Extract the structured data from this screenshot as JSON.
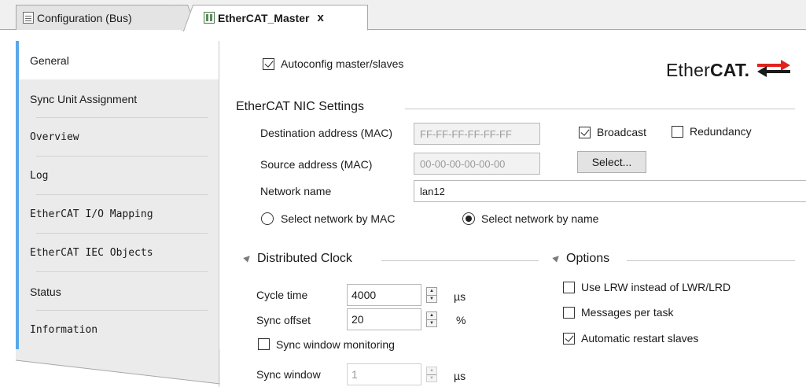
{
  "tabs": [
    {
      "label": "Configuration (Bus)",
      "active": false
    },
    {
      "label": "EtherCAT_Master",
      "active": true,
      "close": "x"
    }
  ],
  "nav": {
    "items": [
      {
        "label": "General",
        "active": true
      },
      {
        "label": "Sync Unit Assignment",
        "active": false
      },
      {
        "label": "Overview",
        "active": false
      },
      {
        "label": "Log",
        "active": false
      },
      {
        "label": "EtherCAT I/O Mapping",
        "active": false
      },
      {
        "label": "EtherCAT IEC Objects",
        "active": false
      },
      {
        "label": "Status",
        "active": false
      },
      {
        "label": "Information",
        "active": false
      }
    ]
  },
  "general": {
    "autoconfig_label": "Autoconfig master/slaves",
    "autoconfig_checked": true,
    "logo": {
      "prefix": "Ether",
      "bold": "CAT",
      "mark": "."
    },
    "nic": {
      "title": "EtherCAT NIC Settings",
      "dest_label": "Destination address (MAC)",
      "dest_value": "FF-FF-FF-FF-FF-FF",
      "broadcast_label": "Broadcast",
      "broadcast_checked": true,
      "redundancy_label": "Redundancy",
      "redundancy_checked": false,
      "source_label": "Source address (MAC)",
      "source_value": "00-00-00-00-00-00",
      "select_button": "Select...",
      "network_name_label": "Network name",
      "network_name_value": "lan12",
      "radio_mac_label": "Select network by MAC",
      "radio_name_label": "Select network by name",
      "selected_radio": "name"
    },
    "distributed_clock": {
      "title": "Distributed Clock",
      "cycle_time_label": "Cycle time",
      "cycle_time_value": "4000",
      "cycle_time_unit": "µs",
      "sync_offset_label": "Sync offset",
      "sync_offset_value": "20",
      "sync_offset_unit": "%",
      "sync_window_monitoring_label": "Sync window monitoring",
      "sync_window_monitoring_checked": false,
      "sync_window_label": "Sync window",
      "sync_window_value": "1",
      "sync_window_unit": "µs"
    },
    "options": {
      "title": "Options",
      "lrw_label": "Use LRW instead of LWR/LRD",
      "lrw_checked": false,
      "messages_label": "Messages per task",
      "messages_checked": false,
      "restart_label": "Automatic restart slaves",
      "restart_checked": true
    }
  },
  "colors": {
    "nav_accent": "#5aa8e8",
    "logo_arrow": "#e0231c"
  }
}
